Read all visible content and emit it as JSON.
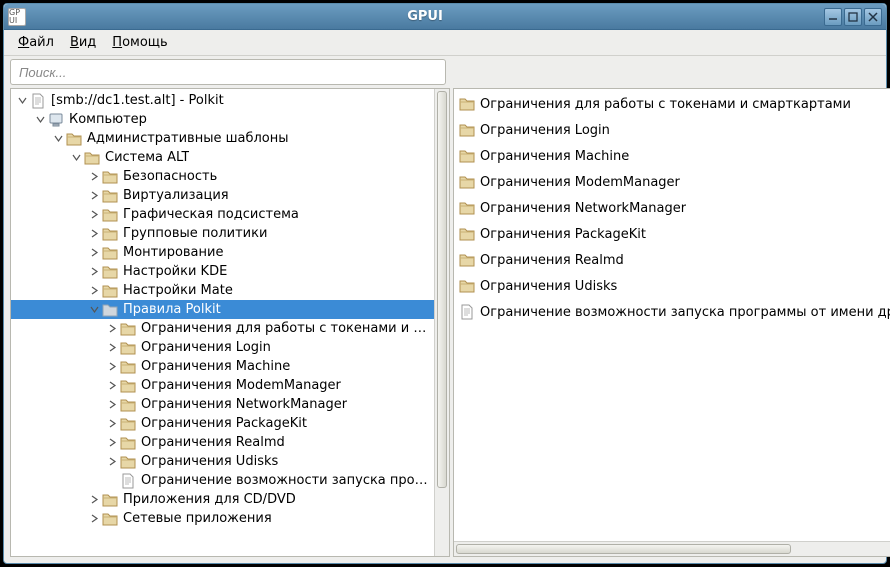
{
  "window": {
    "title": "GPUI",
    "app_icon_text": "GP\nUI"
  },
  "menu": {
    "file": "Файл",
    "view": "Вид",
    "help": "Помощь"
  },
  "search": {
    "placeholder": "Поиск..."
  },
  "tree": {
    "root": {
      "label": "[smb://dc1.test.alt] - Polkit"
    },
    "computer": {
      "label": "Компьютер"
    },
    "admin_templates": {
      "label": "Административные шаблоны"
    },
    "system_alt": {
      "label": "Система ALT"
    },
    "alt_children": [
      {
        "label": "Безопасность"
      },
      {
        "label": "Виртуализация"
      },
      {
        "label": "Графическая подсистема"
      },
      {
        "label": "Групповые политики"
      },
      {
        "label": "Монтирование"
      },
      {
        "label": "Настройки KDE"
      },
      {
        "label": "Настройки Mate"
      }
    ],
    "polkit": {
      "label": "Правила Polkit"
    },
    "polkit_children": [
      {
        "label": "Ограничения для работы с токенами и сма...",
        "type": "folder"
      },
      {
        "label": "Ограничения Login",
        "type": "folder"
      },
      {
        "label": "Ограничения Machine",
        "type": "folder"
      },
      {
        "label": "Ограничения ModemManager",
        "type": "folder"
      },
      {
        "label": "Ограничения NetworkManager",
        "type": "folder"
      },
      {
        "label": "Ограничения PackageKit",
        "type": "folder"
      },
      {
        "label": "Ограничения Realmd",
        "type": "folder"
      },
      {
        "label": "Ограничения Udisks",
        "type": "folder"
      },
      {
        "label": "Ограничение возможности запуска програ...",
        "type": "doc"
      }
    ],
    "after_polkit": [
      {
        "label": "Приложения для CD/DVD"
      },
      {
        "label": "Сетевые приложения"
      }
    ]
  },
  "right_items": [
    {
      "label": "Ограничения для работы с токенами и смарткартами",
      "type": "folder"
    },
    {
      "label": "Ограничения Login",
      "type": "folder"
    },
    {
      "label": "Ограничения Machine",
      "type": "folder"
    },
    {
      "label": "Ограничения ModemManager",
      "type": "folder"
    },
    {
      "label": "Ограничения NetworkManager",
      "type": "folder"
    },
    {
      "label": "Ограничения PackageKit",
      "type": "folder"
    },
    {
      "label": "Ограничения Realmd",
      "type": "folder"
    },
    {
      "label": "Ограничения Udisks",
      "type": "folder"
    },
    {
      "label": "Ограничение возможности запуска программы от имени другог",
      "type": "doc"
    }
  ],
  "colors": {
    "selection": "#3b8bd6"
  }
}
